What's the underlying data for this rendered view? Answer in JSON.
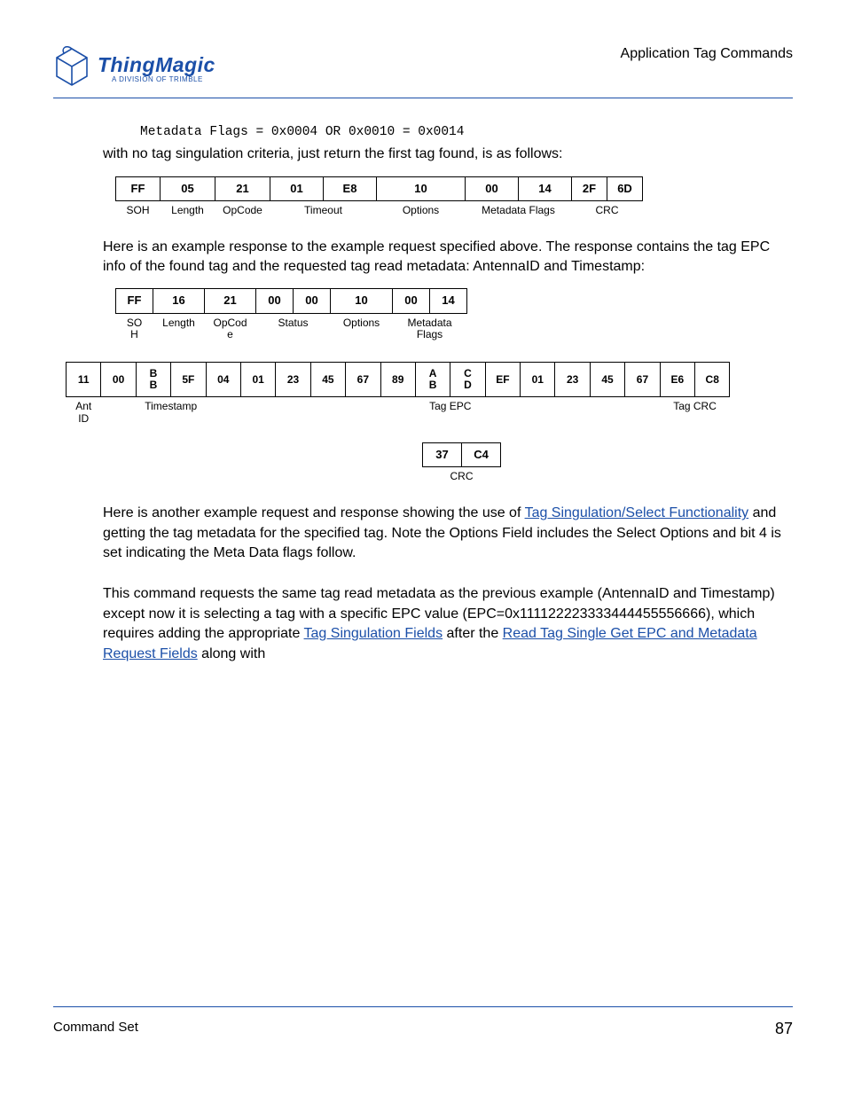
{
  "header": {
    "logo_main": "ThingMagic",
    "logo_sub": "A DIVISION OF TRIMBLE",
    "section_title": "Application Tag Commands"
  },
  "code_line": "Metadata Flags = 0x0004 OR 0x0010 = 0x0014",
  "para_intro": "with no tag singulation criteria, just return the first tag found, is as follows:",
  "table1": {
    "bytes": [
      "FF",
      "05",
      "21",
      "01",
      "E8",
      "10",
      "00",
      "14",
      "2F",
      "6D"
    ],
    "labels": [
      "SOH",
      "Length",
      "OpCode",
      "Timeout",
      "Options",
      "Metadata Flags",
      "CRC"
    ]
  },
  "para_mid": "Here is an example response to the example request specified above. The response contains the tag EPC info of the found tag and the requested tag read metadata: AntennaID and Timestamp:",
  "table2": {
    "bytes": [
      "FF",
      "16",
      "21",
      "00",
      "00",
      "10",
      "00",
      "14"
    ],
    "labels": [
      "SO\nH",
      "Length",
      "OpCod\ne",
      "Status",
      "Options",
      "Metadata\nFlags"
    ]
  },
  "table3": {
    "bytes": [
      "11",
      "00",
      "BB",
      "5F",
      "04",
      "01",
      "23",
      "45",
      "67",
      "89",
      "AB",
      "CD",
      "EF",
      "01",
      "23",
      "45",
      "67",
      "E6",
      "C8"
    ],
    "labels": [
      "Ant\nID",
      "Timestamp",
      "Tag EPC",
      "Tag CRC"
    ]
  },
  "table4": {
    "bytes": [
      "37",
      "C4"
    ],
    "labels": [
      "CRC"
    ]
  },
  "para_after1_a": "Here is another example request and response showing the use of ",
  "link1": "Tag Singulation/Select Functionality",
  "para_after1_b": " and getting the tag metadata for the specified tag. Note the Options Field includes the Select Options and bit 4 is set indicating the Meta Data flags follow.",
  "para_after2_a": "This command requests the same tag read metadata as the previous example (AntennaID and Timestamp) except now it is selecting a tag with a specific EPC value (EPC=0x111122223333444455556666), which requires adding the appropriate ",
  "link2": "Tag Singulation Fields",
  "para_after2_b": " after the ",
  "link3": "Read Tag Single Get EPC and Metadata Request Fields",
  "para_after2_c": " along with",
  "footer": {
    "left": "Command Set",
    "right": "87"
  }
}
